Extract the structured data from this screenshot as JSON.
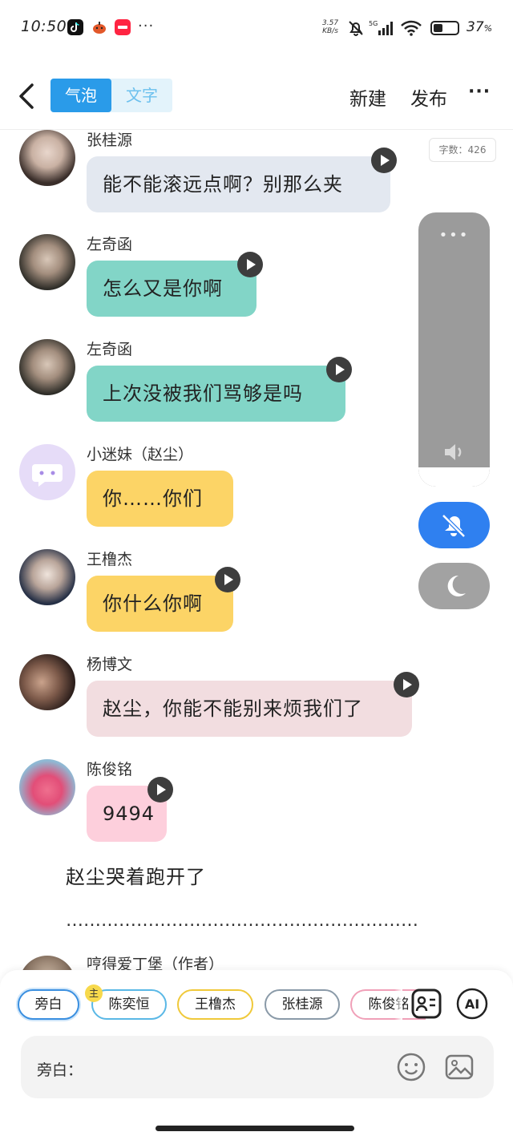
{
  "status_bar": {
    "time": "10:50",
    "net_speed": "3.57",
    "net_unit": "KB/s",
    "signal_label": "5G",
    "battery": "37",
    "battery_unit": "%",
    "more": "···"
  },
  "header": {
    "tabs": [
      {
        "label": "气泡",
        "active": true
      },
      {
        "label": "文字",
        "active": false
      }
    ],
    "new_label": "新建",
    "publish_label": "发布",
    "more_label": "···"
  },
  "word_count": "字数：426",
  "messages": [
    {
      "name": "张桂源",
      "text": "能不能滚远点啊？别那么夹",
      "color": "#e3e8f0",
      "avatar": "boy-photo"
    },
    {
      "name": "左奇函",
      "text": "怎么又是你啊",
      "color": "#82d5c7",
      "avatar": "boy-photo"
    },
    {
      "name": "左奇函",
      "text": "上次没被我们骂够是吗",
      "color": "#82d5c7",
      "avatar": "boy-photo"
    },
    {
      "name": "小迷妹（赵尘）",
      "text": "你……你们",
      "color": "#fcd466",
      "avatar": "purple-chat-icon"
    },
    {
      "name": "王橹杰",
      "text": "你什么你啊",
      "color": "#fcd466",
      "avatar": "boy-photo"
    },
    {
      "name": "杨博文",
      "text": "赵尘，你能不能别来烦我们了",
      "color": "#f2dde0",
      "avatar": "boy-photo"
    },
    {
      "name": "陈俊铭",
      "text": "9494",
      "color": "#fdcfdc",
      "avatar": "pink-outfit-photo"
    }
  ],
  "narration": "赵尘哭着跑开了",
  "divider": "……………………………………………………",
  "partial_name": "哼得爱丁堡（作者）",
  "chips": [
    {
      "label": "旁白",
      "color": "#3a8fe0"
    },
    {
      "label": "陈奕恒",
      "color": "#5ab8e6"
    },
    {
      "label": "王橹杰",
      "color": "#f0c93a"
    },
    {
      "label": "张桂源",
      "color": "#8a9aa8"
    },
    {
      "label": "陈俊铭",
      "color": "#f0a0b8"
    }
  ],
  "host_badge": "主",
  "ai_label": "AI",
  "composer": {
    "role_label": "旁白：",
    "placeholder": ""
  }
}
